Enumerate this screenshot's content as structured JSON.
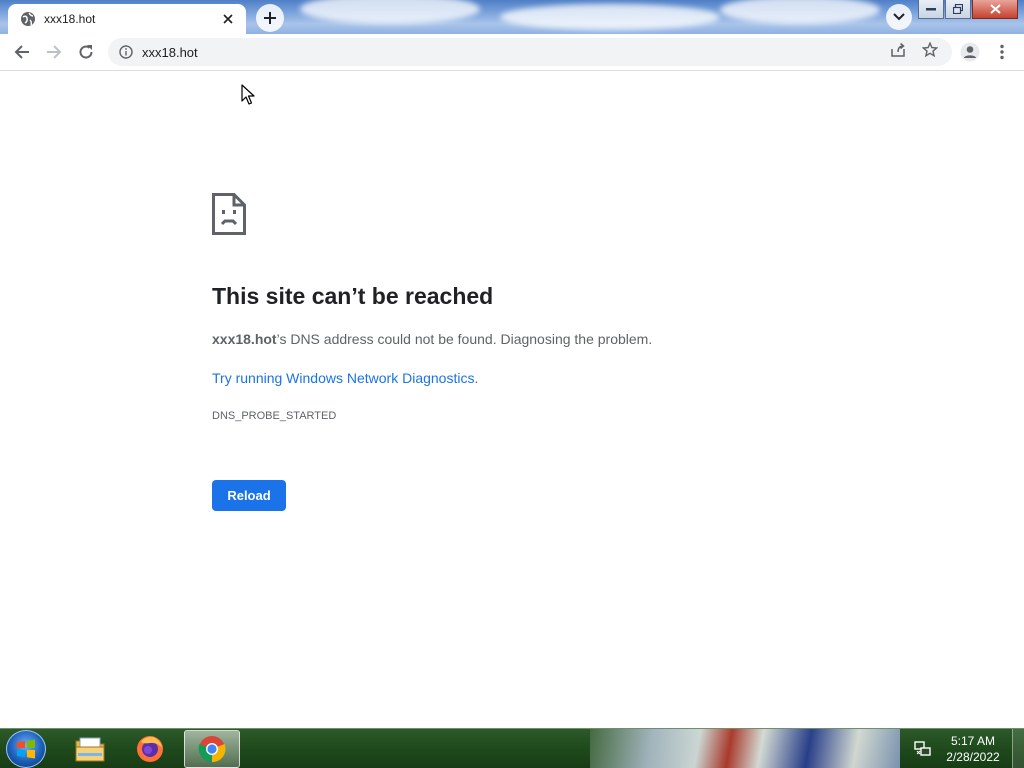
{
  "tab": {
    "title": "xxx18.hot",
    "favicon": "globe-icon",
    "close_icon": "close-icon"
  },
  "new_tab_icon": "plus-icon",
  "tab_search_icon": "chevron-down-icon",
  "window_controls": [
    "minimize-icon",
    "restore-icon",
    "close-icon"
  ],
  "toolbar": {
    "back_icon": "arrow-left-icon",
    "forward_icon": "arrow-right-icon",
    "reload_icon": "reload-icon",
    "url": "xxx18.hot",
    "site_info_icon": "info-icon",
    "share_icon": "share-icon",
    "bookmark_icon": "star-icon",
    "profile_icon": "profile-icon",
    "menu_icon": "kebab-menu-icon"
  },
  "error": {
    "title": "This site can’t be reached",
    "host": "xxx18.hot",
    "message_rest": "’s DNS address could not be found. Diagnosing the problem.",
    "diagnostics_link": "Try running Windows Network Diagnostics",
    "diagnostics_period": ".",
    "code": "DNS_PROBE_STARTED",
    "reload_label": "Reload"
  },
  "taskbar": {
    "items": [
      "start-orb",
      "file-explorer-icon",
      "firefox-icon",
      "chrome-icon"
    ],
    "active": "chrome-icon",
    "tray_network_icon": "network-icon",
    "time": "5:17 AM",
    "date": "2/28/2022"
  },
  "colors": {
    "accent": "#1a73e8",
    "title_text": "#202124",
    "body_text": "#5f6368"
  }
}
